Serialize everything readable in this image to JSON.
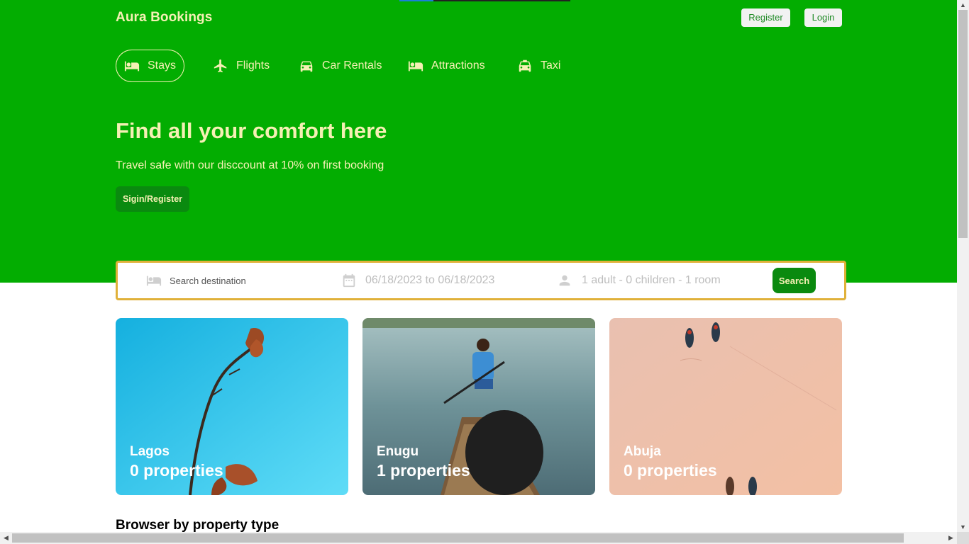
{
  "header": {
    "brand": "Aura Bookings",
    "register_label": "Register",
    "login_label": "Login"
  },
  "nav": {
    "items": [
      {
        "label": "Stays",
        "icon": "bed-icon",
        "active": true
      },
      {
        "label": "Flights",
        "icon": "plane-icon",
        "active": false
      },
      {
        "label": "Car Rentals",
        "icon": "car-icon",
        "active": false
      },
      {
        "label": "Attractions",
        "icon": "bed-icon",
        "active": false
      },
      {
        "label": "Taxi",
        "icon": "taxi-icon",
        "active": false
      }
    ]
  },
  "hero": {
    "title": "Find all your comfort here",
    "subtitle": "Travel safe with our disccount at 10% on first booking",
    "cta_label": "Sigin/Register"
  },
  "search": {
    "destination_placeholder": "Search destination",
    "date_range": "06/18/2023 to 06/18/2023",
    "guests": "1 adult - 0 children - 1 room",
    "button_label": "Search"
  },
  "cities": [
    {
      "name": "Lagos",
      "properties": "0 properties"
    },
    {
      "name": "Enugu",
      "properties": "1 properties"
    },
    {
      "name": "Abuja",
      "properties": "0 properties"
    }
  ],
  "sections": {
    "property_type_title": "Browser by property type"
  },
  "colors": {
    "brand_green": "#03ad01",
    "button_green": "#0a8a0f",
    "accent_cream": "#f5f0b4",
    "search_border": "#e0b13a"
  }
}
